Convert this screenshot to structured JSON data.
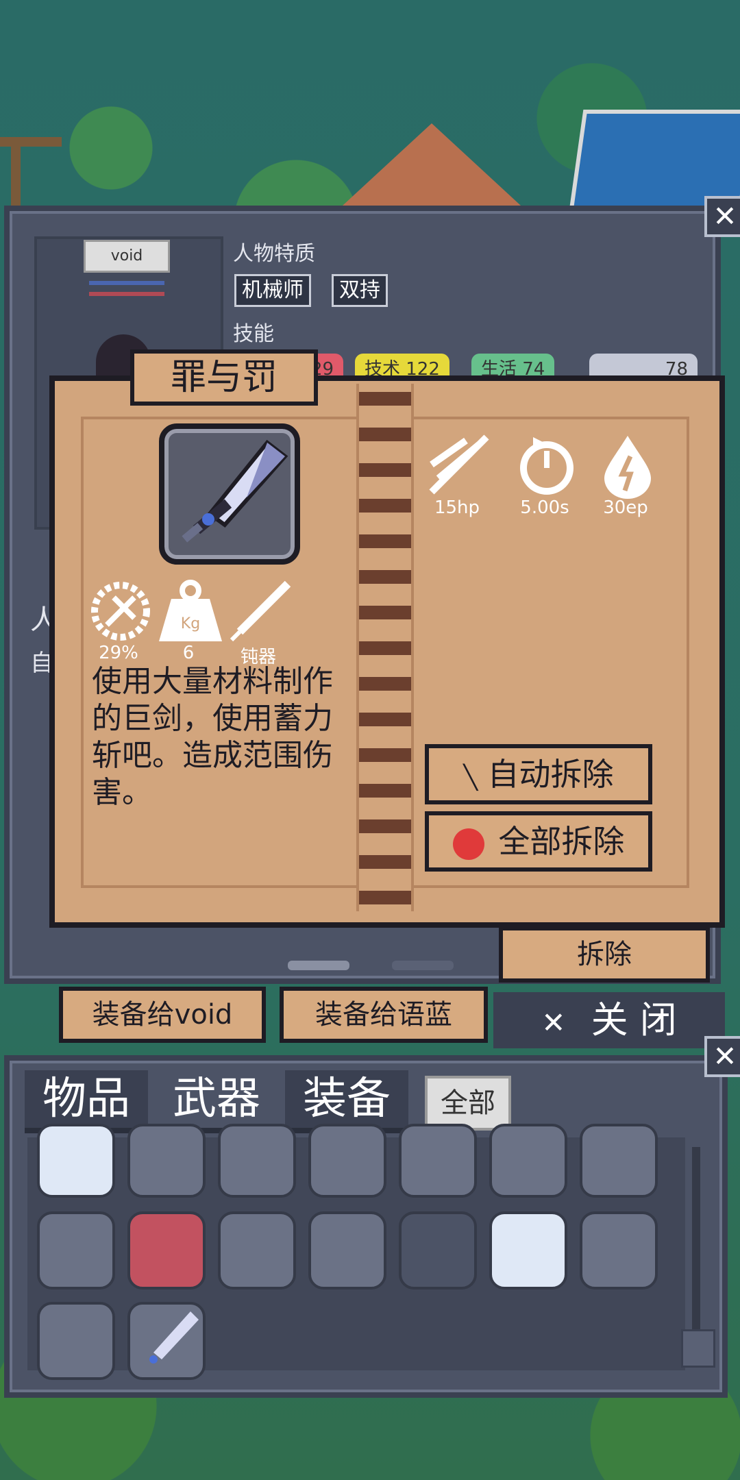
{
  "character": {
    "name": "void",
    "traits_label": "人物特质",
    "traits": [
      "机械师",
      "双持"
    ],
    "skills_label": "技能",
    "skill_tabs": [
      {
        "label": "29",
        "color": "#e05a6a"
      },
      {
        "label": "技术 122",
        "color": "#e6d93a"
      },
      {
        "label": "生活 74",
        "color": "#67c08c"
      },
      {
        "label": "78",
        "color": "#c4c8d6"
      }
    ],
    "side_text": [
      "人",
      "自"
    ]
  },
  "item": {
    "name": "罪与罚",
    "stats": [
      {
        "icon": "slash-icon",
        "value": "15hp"
      },
      {
        "icon": "cooldown-icon",
        "value": "5.00s"
      },
      {
        "icon": "energy-drop-icon",
        "value": "30ep"
      }
    ],
    "attributes": [
      {
        "icon": "crit-gear-icon",
        "value": "29%"
      },
      {
        "icon": "weight-icon",
        "value": "6",
        "inner": "Kg"
      },
      {
        "icon": "blade-icon",
        "value": "钝器"
      }
    ],
    "description": "使用大量材料制作的巨剑，使用蓄力斩吧。造成范围伤害。",
    "auto_dismantle": "自动拆除",
    "dismantle_all": "全部拆除",
    "dismantle": "拆除"
  },
  "actions": {
    "equip_void": "装备给void",
    "equip_yulan": "装备给语蓝",
    "close": "关 闭",
    "close_x": "✕"
  },
  "inventory": {
    "tabs": [
      "物品",
      "武器",
      "装备"
    ],
    "filter": "全部",
    "rows": [
      [
        "sword-icon",
        "gun-icon",
        "gun-icon",
        "gun-icon",
        "rifle-icon",
        "case-icon",
        "case-icon"
      ],
      [
        "launcher-icon",
        "dual-blade-icon",
        "red-saber-icon",
        "briefcase-icon",
        "chip-icon",
        "minigun-icon",
        "minigun-icon"
      ],
      [
        "claw-icon",
        "greatsword-icon"
      ]
    ]
  },
  "colors": {
    "panel": "#4c5366",
    "book": "#d2a57d",
    "ink": "#1e1c24"
  }
}
